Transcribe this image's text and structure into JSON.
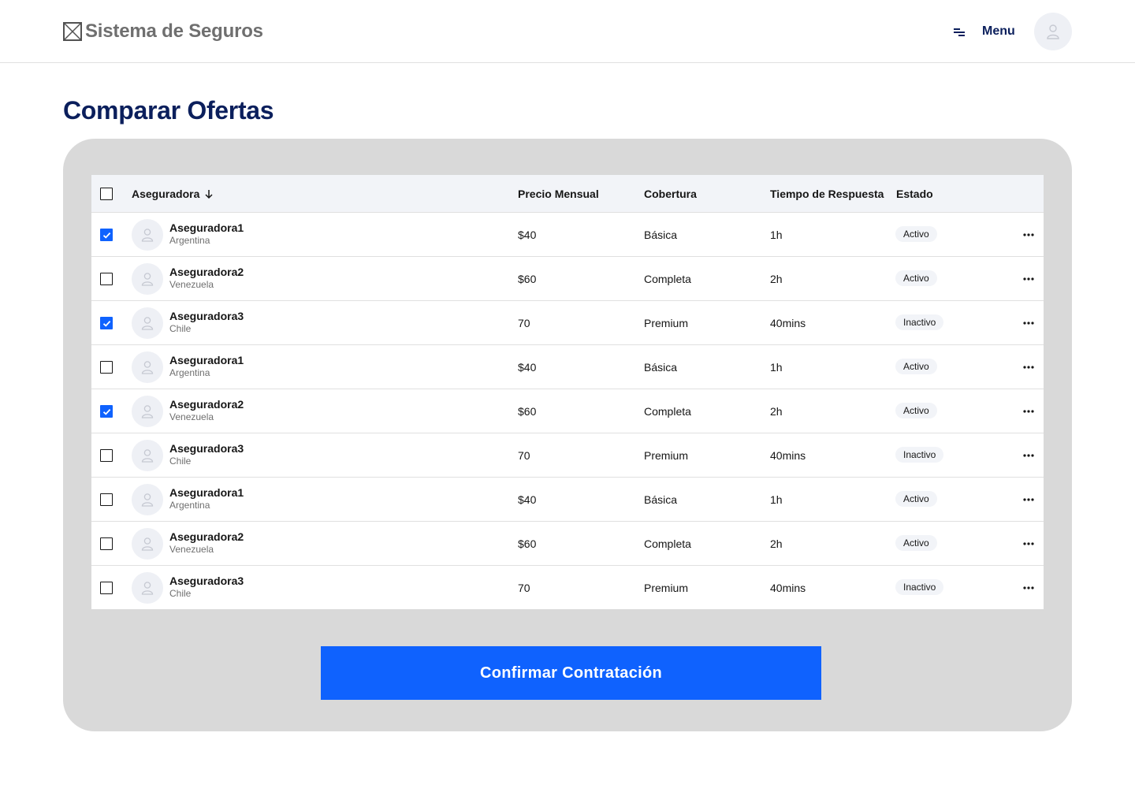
{
  "app": {
    "title": "Sistema de Seguros",
    "logo_icon": "image-placeholder-icon"
  },
  "header": {
    "menu_label": "Menu",
    "menu_icon": "menu-lines-icon",
    "avatar_icon": "user-icon"
  },
  "page": {
    "title": "Comparar Ofertas"
  },
  "table": {
    "columns": {
      "insurer": "Aseguradora",
      "price": "Precio Mensual",
      "coverage": "Cobertura",
      "response": "Tiempo de Respuesta",
      "status": "Estado"
    },
    "sort_icon": "arrow-down-icon",
    "select_all_checked": false,
    "rows": [
      {
        "name": "Aseguradora1",
        "country": "Argentina",
        "price": "$40",
        "coverage": "Básica",
        "response": "1h",
        "status": "Activo",
        "checked": true
      },
      {
        "name": "Aseguradora2",
        "country": "Venezuela",
        "price": "$60",
        "coverage": "Completa",
        "response": "2h",
        "status": "Activo",
        "checked": false
      },
      {
        "name": "Aseguradora3",
        "country": "Chile",
        "price": "70",
        "coverage": "Premium",
        "response": "40mins",
        "status": "Inactivo",
        "checked": true
      },
      {
        "name": "Aseguradora1",
        "country": "Argentina",
        "price": "$40",
        "coverage": "Básica",
        "response": "1h",
        "status": "Activo",
        "checked": false
      },
      {
        "name": "Aseguradora2",
        "country": "Venezuela",
        "price": "$60",
        "coverage": "Completa",
        "response": "2h",
        "status": "Activo",
        "checked": true
      },
      {
        "name": "Aseguradora3",
        "country": "Chile",
        "price": "70",
        "coverage": "Premium",
        "response": "40mins",
        "status": "Inactivo",
        "checked": false
      },
      {
        "name": "Aseguradora1",
        "country": "Argentina",
        "price": "$40",
        "coverage": "Básica",
        "response": "1h",
        "status": "Activo",
        "checked": false
      },
      {
        "name": "Aseguradora2",
        "country": "Venezuela",
        "price": "$60",
        "coverage": "Completa",
        "response": "2h",
        "status": "Activo",
        "checked": false
      },
      {
        "name": "Aseguradora3",
        "country": "Chile",
        "price": "70",
        "coverage": "Premium",
        "response": "40mins",
        "status": "Inactivo",
        "checked": false
      }
    ]
  },
  "actions": {
    "confirm_label": "Confirmar Contratación"
  },
  "colors": {
    "primary": "#0f62fe",
    "title_navy": "#0b1f5c",
    "panel_gray": "#d9d9d9",
    "header_row": "#f2f4f8"
  }
}
